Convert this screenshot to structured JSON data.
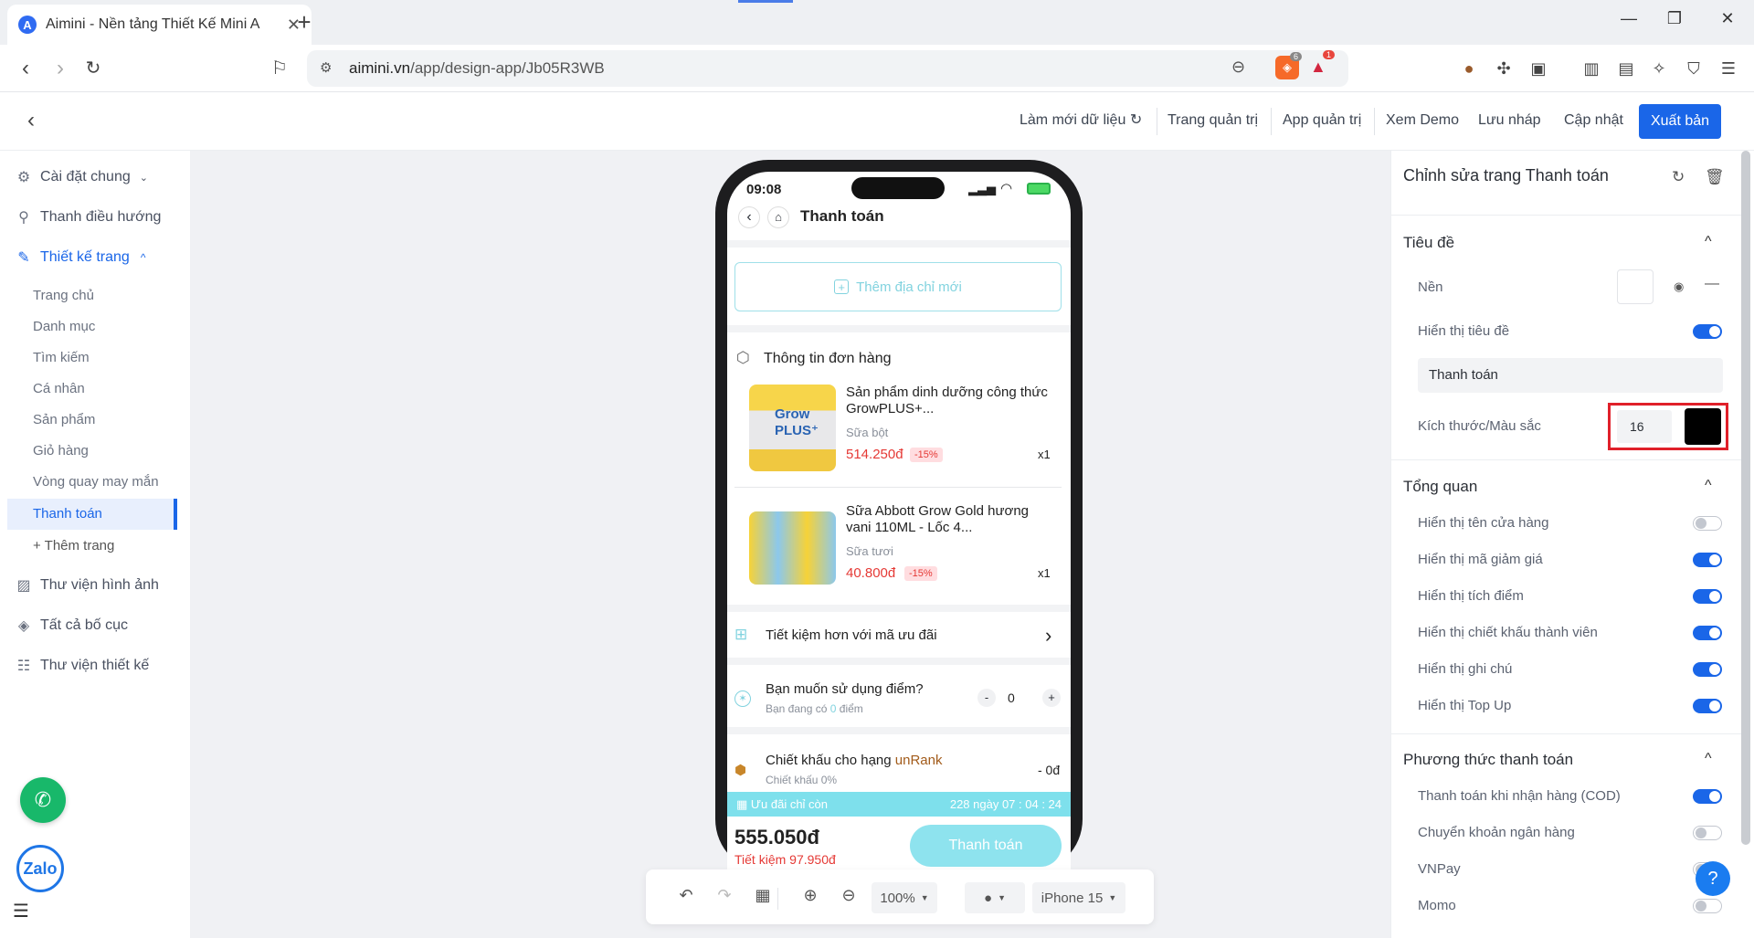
{
  "browser": {
    "tab_title": "Aimini - Nền tảng Thiết Kế Mini A",
    "tab_icon": "A",
    "url_host": "aimini.vn",
    "url_path": "/app/design-app/Jb05R3WB",
    "ext_badge_1": "6",
    "ext_badge_2": "1"
  },
  "header": {
    "refresh_data": "Làm mới dữ liệu",
    "admin_page": "Trang quản trị",
    "admin_app": "App quản trị",
    "demo": "Xem Demo",
    "save_draft": "Lưu nháp",
    "update": "Cập nhật",
    "publish": "Xuất bản"
  },
  "sidebar": {
    "general": "Cài đặt chung",
    "nav": "Thanh điều hướng",
    "design": "Thiết kế trang",
    "pages": [
      "Trang chủ",
      "Danh mục",
      "Tìm kiếm",
      "Cá nhân",
      "Sản phẩm",
      "Giỏ hàng",
      "Vòng quay may mắn",
      "Thanh toán"
    ],
    "add_page": "+ Thêm trang",
    "image_lib": "Thư viện hình ảnh",
    "layouts": "Tất cả bố cục",
    "design_lib": "Thư viện thiết kế",
    "zalo": "Zalo"
  },
  "phone": {
    "time": "09:08",
    "title": "Thanh toán",
    "add_address": "Thêm địa chỉ mới",
    "order_info": "Thông tin đơn hàng",
    "products": [
      {
        "name": "Sản phẩm dinh dưỡng công thức GrowPLUS+...",
        "type": "Sữa bột",
        "price": "514.250đ",
        "discount": "-15%",
        "qty": "x1"
      },
      {
        "name": "Sữa Abbott Grow Gold hương vani 110ML - Lốc 4...",
        "type": "Sữa tươi",
        "price": "40.800đ",
        "discount": "-15%",
        "qty": "x1"
      }
    ],
    "save_more": "Tiết kiệm hơn với mã ưu đãi",
    "use_points": "Bạn muốn sử dụng điểm?",
    "points_have_pre": "Bạn đang có",
    "points_have_val": "0",
    "points_have_post": "điểm",
    "stepper_minus": "-",
    "stepper_val": "0",
    "stepper_plus": "+",
    "rank_discount_pre": "Chiết khấu cho hạng",
    "rank_name": "unRank",
    "rank_pct": "Chiết khấu 0%",
    "rank_amount": "- 0đ",
    "timer_label": "Ưu đãi chỉ còn",
    "timer_value": "228 ngày 07 : 04 : 24",
    "total": "555.050đ",
    "saving_label": "Tiết kiệm",
    "saving_value": "97.950đ",
    "pay": "Thanh toán"
  },
  "zoombar": {
    "zoom": "100%",
    "device": "iPhone 15"
  },
  "panel": {
    "title": "Chỉnh sửa trang Thanh toán",
    "sec_title": "Tiêu đề",
    "bg": "Nền",
    "show_title": "Hiển thị tiêu đề",
    "title_value": "Thanh toán",
    "size_color": "Kích thước/Màu sắc",
    "size_value": "16",
    "sec_overview": "Tổng quan",
    "overview": [
      {
        "label": "Hiển thị tên cửa hàng",
        "on": false
      },
      {
        "label": "Hiển thị mã giảm giá",
        "on": true
      },
      {
        "label": "Hiển thị tích điểm",
        "on": true
      },
      {
        "label": "Hiển thị chiết khấu thành viên",
        "on": true
      },
      {
        "label": "Hiển thị ghi chú",
        "on": true
      },
      {
        "label": "Hiển thị Top Up",
        "on": true
      }
    ],
    "sec_payment": "Phương thức thanh toán",
    "payments": [
      {
        "label": "Thanh toán khi nhận hàng (COD)",
        "on": true
      },
      {
        "label": "Chuyển khoản ngân hàng",
        "on": false
      },
      {
        "label": "VNPay",
        "on": false
      },
      {
        "label": "Momo",
        "on": false
      }
    ],
    "help": "?"
  },
  "colors": {
    "accent": "#1a66e8",
    "highlight": "#e0202a",
    "teal": "#7ee0ec",
    "price": "#e53935"
  }
}
